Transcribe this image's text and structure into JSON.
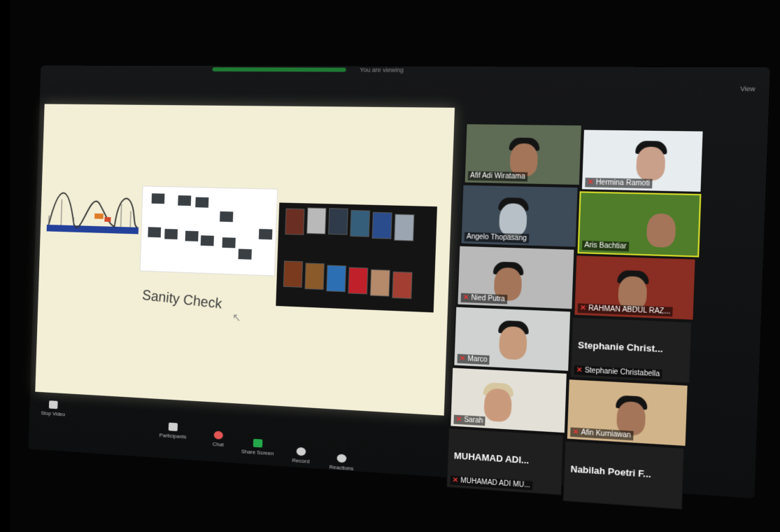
{
  "top_bar": {
    "share_text": "You are viewing",
    "view_text": "View"
  },
  "slide": {
    "title": "Sanity Check"
  },
  "participants": [
    {
      "name": "Afif Adi Wiratama",
      "muted": false,
      "video": true
    },
    {
      "name": "Hermina Ramoti",
      "muted": true,
      "video": true
    },
    {
      "name": "Angelo Thopasang",
      "muted": false,
      "video": true
    },
    {
      "name": "Aris Bachtiar",
      "muted": false,
      "video": true,
      "active": true
    },
    {
      "name": "Nied Putra",
      "muted": true,
      "video": true
    },
    {
      "name": "RAHMAN ABDUL RAZ...",
      "muted": true,
      "video": true
    },
    {
      "name": "Marco",
      "muted": true,
      "video": true
    },
    {
      "name": "Stephanie Christ...",
      "sub": "Stephanie Christabella",
      "muted": true,
      "video": false
    },
    {
      "name": "Sarah",
      "muted": true,
      "video": true
    },
    {
      "name": "Afin Kurniawan",
      "muted": true,
      "video": true
    },
    {
      "name": "MUHAMAD ADI...",
      "sub": "MUHAMAD ADI MU...",
      "muted": true,
      "video": false
    },
    {
      "name": "Nabilah Poetri F...",
      "muted": false,
      "video": false
    }
  ],
  "controls": {
    "video": "Stop Video",
    "participants": "Participants",
    "chat": "Chat",
    "share": "Share Screen",
    "record": "Record",
    "reactions": "Reactions"
  },
  "colors": {
    "active_speaker": "#d7dc2b",
    "share_green": "#23a84a",
    "muted_red": "#e53935"
  }
}
